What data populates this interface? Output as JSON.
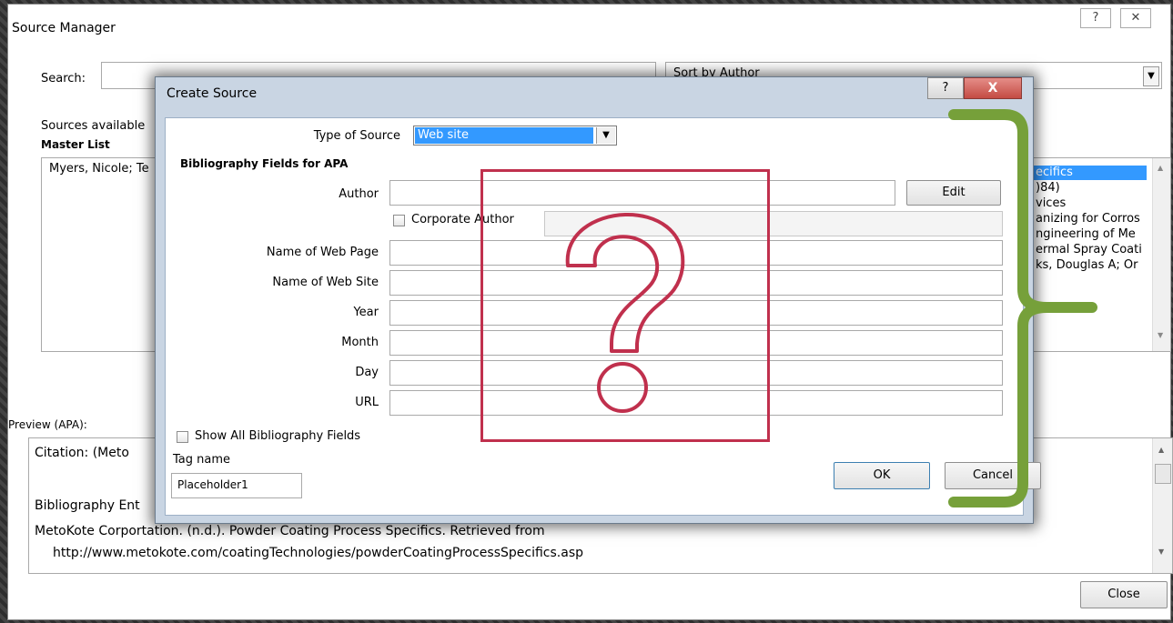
{
  "source_manager": {
    "title": "Source Manager",
    "help_symbol": "?",
    "close_symbol": "✕",
    "search_label": "Search:",
    "search_value": "",
    "sort_value": "Sort by Author",
    "sources_available_label": "Sources available",
    "master_list_label": "Master List",
    "master_list_items": [
      "Myers, Nicole; Te"
    ],
    "current_list_items": [
      "ecifics",
      ")84)",
      "vices",
      "anizing for Corros",
      "ngineering of Me",
      "ermal Spray Coati",
      "ks, Douglas A; Or"
    ],
    "preview_label": "Preview (APA):",
    "preview_citation": "Citation:  (Meto",
    "preview_bibliography_label": "Bibliography Ent",
    "preview_bibliography_line1": "MetoKote Corportation. (n.d.). Powder Coating Process Specifics. Retrieved from",
    "preview_bibliography_line2": "http://www.metokote.com/coatingTechnologies/powderCoatingProcessSpecifics.asp",
    "close_button": "Close"
  },
  "create_source": {
    "title": "Create Source",
    "help_symbol": "?",
    "close_symbol": "X",
    "type_of_source_label": "Type of Source",
    "type_of_source_value": "Web site",
    "bibliography_fields_label": "Bibliography Fields for APA",
    "author_label": "Author",
    "author_value": "",
    "edit_button": "Edit",
    "corporate_author_label": "Corporate Author",
    "corporate_author_value": "",
    "name_of_web_page_label": "Name of Web Page",
    "name_of_web_page_value": "",
    "name_of_web_site_label": "Name of Web Site",
    "name_of_web_site_value": "",
    "year_label": "Year",
    "year_value": "",
    "month_label": "Month",
    "month_value": "",
    "day_label": "Day",
    "day_value": "",
    "url_label": "URL",
    "url_value": "",
    "show_all_label": "Show All Bibliography Fields",
    "tag_name_label": "Tag name",
    "tag_name_value": "Placeholder1",
    "ok_button": "OK",
    "cancel_button": "Cancel"
  },
  "annotations": {
    "question_mark_color": "#c0304d",
    "bracket_color": "#76a03a"
  }
}
